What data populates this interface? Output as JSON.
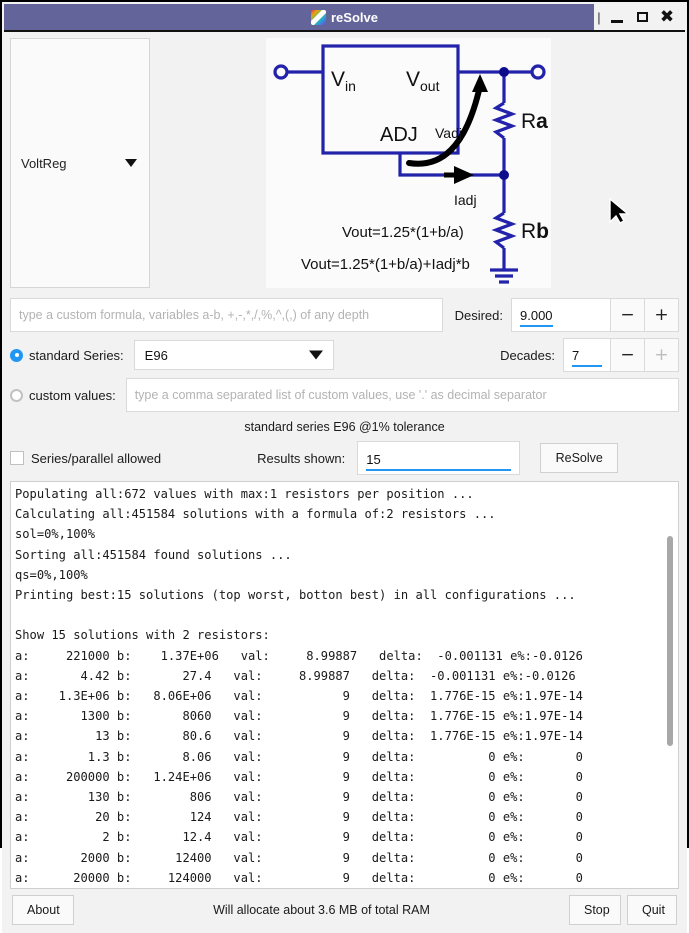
{
  "window": {
    "title": "reSolve",
    "icon": "app-gradient-icon",
    "buttons": {
      "menu": "|",
      "minimize": "minimize-icon",
      "maximize": "maximize-icon",
      "close": "close-icon"
    },
    "titlebar_color": "#636499"
  },
  "selector": {
    "value": "VoltReg",
    "arrow": "chevron-down-icon"
  },
  "diagram": {
    "vin": "V",
    "vin_sub": "in",
    "vout": "V",
    "vout_sub": "out",
    "adj": "ADJ",
    "vadj": "Vadj",
    "iadj": "Iadj",
    "ra": "R",
    "ra_sub": "a",
    "rb": "R",
    "rb_sub": "b",
    "formula1": "Vout=1.25*(1+b/a)",
    "formula2": "Vout=1.25*(1+b/a)+Iadj*b",
    "line_color": "#2222aa"
  },
  "formula_input": {
    "value": "",
    "placeholder": "type a custom formula, variables a-b, +,-,*,/,%,^,(,) of any depth"
  },
  "desired": {
    "label": "Desired:",
    "value": "9.000",
    "minus": "−",
    "plus": "+"
  },
  "decades": {
    "label": "Decades:",
    "value": "7",
    "minus": "−",
    "plus": "+",
    "plus_disabled": true
  },
  "series_mode": {
    "standard_label": "standard Series:",
    "standard_selected": true,
    "series_value": "E96",
    "custom_label": "custom values:",
    "custom_selected": false,
    "custom_placeholder": "type a comma separated list of custom values, use '.' as decimal separator"
  },
  "tolerance_note": "standard series E96 @1% tolerance",
  "options": {
    "series_parallel_label": "Series/parallel allowed",
    "series_parallel_checked": false,
    "results_shown_label": "Results shown:",
    "results_shown_value": "15",
    "resolve_button": "ReSolve"
  },
  "log": {
    "text": "Populating all:672 values with max:1 resistors per position ...\nCalculating all:451584 solutions with a formula of:2 resistors ...\nsol=0%,100%\nSorting all:451584 found solutions ...\nqs=0%,100%\nPrinting best:15 solutions (top worst, botton best) in all configurations ...\n\nShow 15 solutions with 2 resistors:\na:     221000 b:    1.37E+06   val:     8.99887   delta:  -0.001131 e%:-0.0126\na:       4.42 b:       27.4   val:     8.99887   delta:  -0.001131 e%:-0.0126\na:    1.3E+06 b:   8.06E+06   val:           9   delta:  1.776E-15 e%:1.97E-14\na:       1300 b:       8060   val:           9   delta:  1.776E-15 e%:1.97E-14\na:         13 b:       80.6   val:           9   delta:  1.776E-15 e%:1.97E-14\na:        1.3 b:       8.06   val:           9   delta:          0 e%:       0\na:     200000 b:   1.24E+06   val:           9   delta:          0 e%:       0\na:        130 b:        806   val:           9   delta:          0 e%:       0\na:         20 b:        124   val:           9   delta:          0 e%:       0\na:          2 b:       12.4   val:           9   delta:          0 e%:       0\na:       2000 b:      12400   val:           9   delta:          0 e%:       0\na:      20000 b:     124000   val:           9   delta:          0 e%:       0"
  },
  "footer": {
    "about": "About",
    "status": "Will allocate about 3.6 MB of total RAM",
    "stop": "Stop",
    "quit": "Quit"
  }
}
